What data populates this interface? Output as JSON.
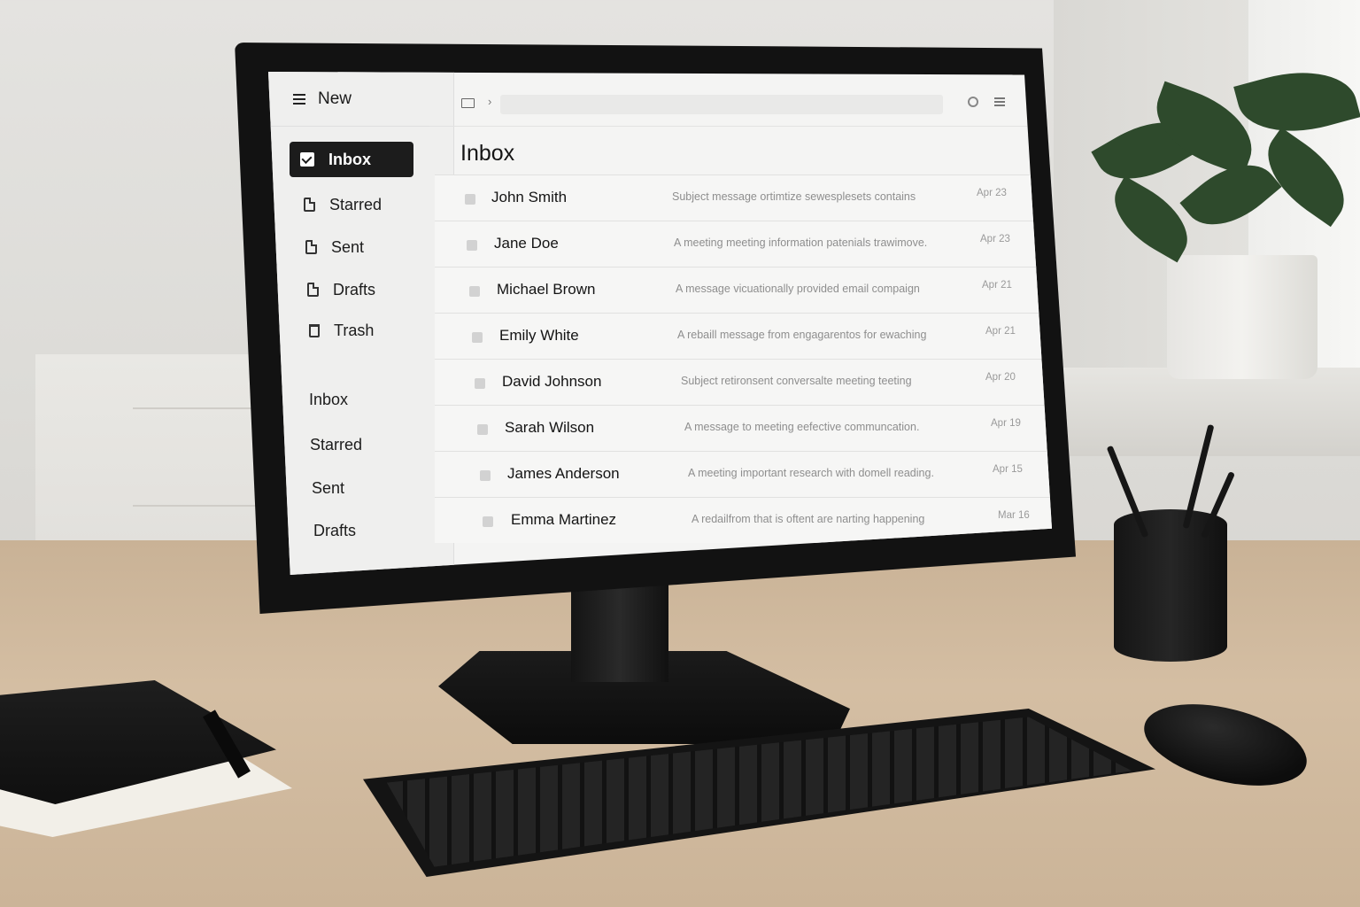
{
  "sidebar": {
    "new_label": "New",
    "items": [
      {
        "label": "Inbox",
        "icon": "check-icon",
        "active": true
      },
      {
        "label": "Starred",
        "icon": "document-icon"
      },
      {
        "label": "Sent",
        "icon": "document-icon"
      },
      {
        "label": "Drafts",
        "icon": "document-icon"
      },
      {
        "label": "Trash",
        "icon": "trash-icon"
      }
    ],
    "secondary": [
      {
        "label": "Inbox"
      },
      {
        "label": "Starred"
      },
      {
        "label": "Sent"
      },
      {
        "label": "Drafts"
      }
    ]
  },
  "toolbar": {
    "chevron": "›",
    "search_placeholder": ""
  },
  "main": {
    "title": "Inbox",
    "emails": [
      {
        "sender": "John Smith",
        "preview": "Subject message ortimtize sewesplesets contains",
        "date": "Apr 23"
      },
      {
        "sender": "Jane Doe",
        "preview": "A meeting meeting information patenials trawimove.",
        "date": "Apr 23"
      },
      {
        "sender": "Michael Brown",
        "preview": "A message vicuationally provided email compaign",
        "date": "Apr 21"
      },
      {
        "sender": "Emily White",
        "preview": "A rebaill message from engagarentos for ewaching",
        "date": "Apr 21"
      },
      {
        "sender": "David Johnson",
        "preview": "Subject retironsent conversalte meeting teeting",
        "date": "Apr 20"
      },
      {
        "sender": "Sarah Wilson",
        "preview": "A message to meeting eefective communcation.",
        "date": "Apr 19"
      },
      {
        "sender": "James Anderson",
        "preview": "A meeting important research with domell reading.",
        "date": "Apr 15"
      },
      {
        "sender": "Emma Martinez",
        "preview": "A redailfrom that is oftent are narting happening",
        "date": "Mar 16"
      }
    ]
  },
  "colors": {
    "active_nav_bg": "#1c1c1c",
    "screen_bg": "#f4f4f3",
    "sidebar_bg": "#efefee"
  }
}
